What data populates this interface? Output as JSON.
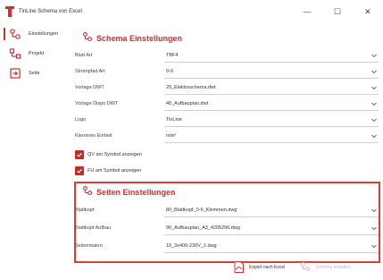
{
  "window": {
    "title": "TinLine Schema von Excel",
    "controls": [
      "—",
      "☐",
      "✕"
    ]
  },
  "sidebar": {
    "items": [
      {
        "label": "Einstellungen",
        "icon": "settings-nodes-icon",
        "active": true
      },
      {
        "label": "Projekt",
        "icon": "project-tree-icon",
        "active": false
      },
      {
        "label": "Seite",
        "icon": "page-arrow-icon",
        "active": false
      }
    ]
  },
  "schema": {
    "title": "Schema Einstellungen",
    "fields": [
      {
        "label": "Blatt Art",
        "value": "TBF4"
      },
      {
        "label": "Strompfad Art",
        "value": "0-9"
      },
      {
        "label": "Vorlage DWT",
        "value": "20_Elektroschema.dwt"
      },
      {
        "label": "Vorlage Dispo DWT",
        "value": "40_Aufbauplan.dwt"
      },
      {
        "label": "Logo",
        "value": "TinLine"
      },
      {
        "label": "Klemmen Einheit",
        "value": "mm²"
      }
    ],
    "checkboxes": [
      {
        "label": "QV am Symbol anzeigen",
        "checked": true
      },
      {
        "label": "FU am Symbol anzeigen",
        "checked": true
      }
    ]
  },
  "seiten": {
    "title": "Seiten Einstellungen",
    "fields": [
      {
        "label": "Blattkopf",
        "value": "80_Blattkopf_0-9_Klemmen.dwg"
      },
      {
        "label": "Blattkopf Aufbau",
        "value": "90_Aufbauplan_A3_4205296.dwg"
      },
      {
        "label": "Seitenmakro",
        "value": "10_3x400-230V_1.dwg"
      }
    ]
  },
  "footer": {
    "export_label": "Export nach Excel",
    "create_label": "Schema erstellen"
  },
  "colors": {
    "accent": "#d32f2f",
    "highlight_border": "#e53935"
  }
}
